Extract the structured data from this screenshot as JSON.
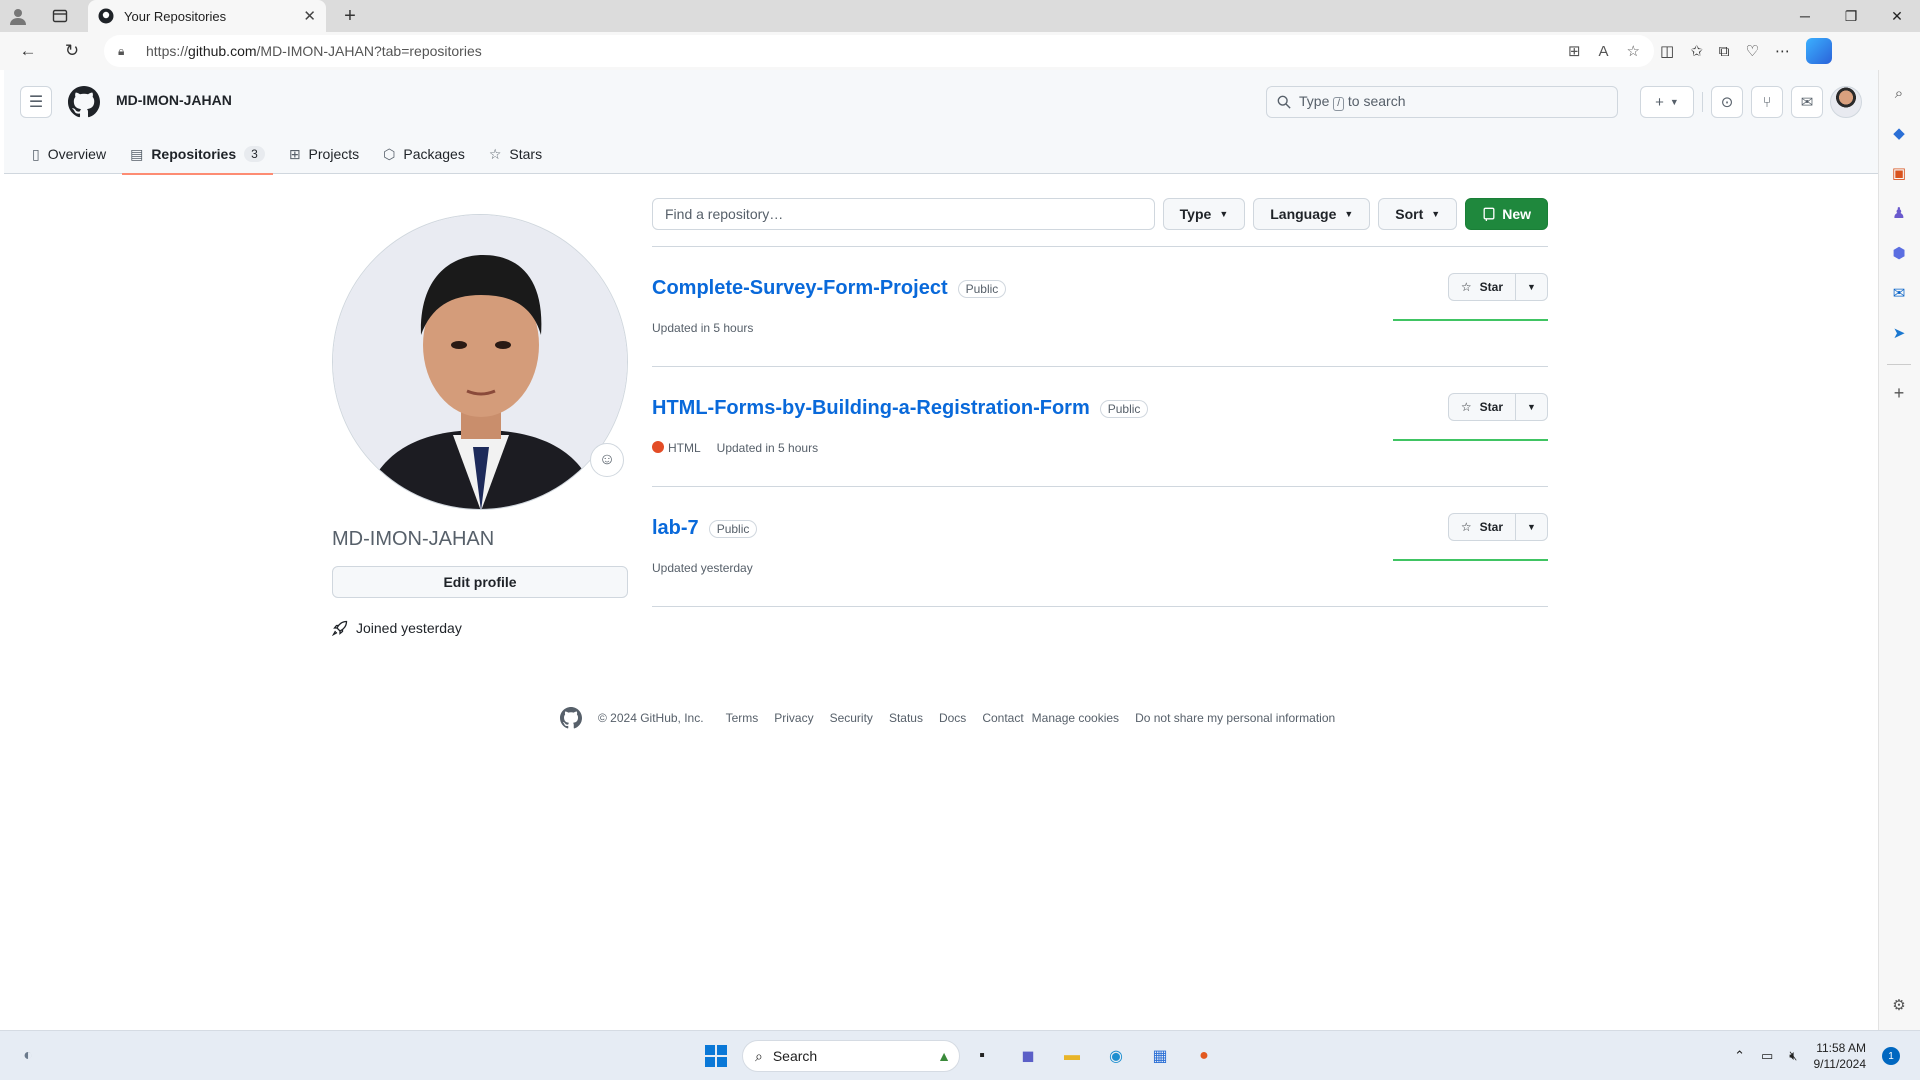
{
  "browser": {
    "tab_title": "Your Repositories",
    "url_prefix": "https://",
    "url_domain": "github.com",
    "url_path": "/MD-IMON-JAHAN?tab=repositories"
  },
  "github": {
    "username_header": "MD-IMON-JAHAN",
    "search_before": "Type",
    "search_key": "/",
    "search_after": "to search",
    "tabs": [
      {
        "label": "Overview"
      },
      {
        "label": "Repositories",
        "count": "3"
      },
      {
        "label": "Projects"
      },
      {
        "label": "Packages"
      },
      {
        "label": "Stars"
      }
    ]
  },
  "profile": {
    "username": "MD-IMON-JAHAN",
    "edit_label": "Edit profile",
    "joined": "Joined yesterday"
  },
  "filters": {
    "find_placeholder": "Find a repository…",
    "type_label": "Type",
    "language_label": "Language",
    "sort_label": "Sort",
    "new_label": "New"
  },
  "repos": [
    {
      "name": "Complete-Survey-Form-Project",
      "visibility": "Public",
      "language": "",
      "updated": "Updated in 5 hours",
      "star_label": "Star"
    },
    {
      "name": "HTML-Forms-by-Building-a-Registration-Form",
      "visibility": "Public",
      "language": "HTML",
      "language_color": "#e34c26",
      "updated": "Updated in 5 hours",
      "star_label": "Star"
    },
    {
      "name": "lab-7",
      "visibility": "Public",
      "language": "",
      "updated": "Updated yesterday",
      "star_label": "Star"
    }
  ],
  "footer": {
    "copyright": "© 2024 GitHub, Inc.",
    "links": [
      "Terms",
      "Privacy",
      "Security",
      "Status",
      "Docs",
      "Contact",
      "Manage cookies",
      "Do not share my personal information"
    ]
  },
  "taskbar": {
    "search_label": "Search",
    "time": "11:58 AM",
    "date": "9/11/2024",
    "notification_count": "1"
  },
  "colors": {
    "accent_green": "#1f883d",
    "link_blue": "#0969da",
    "tab_underline": "#fd8c73"
  }
}
